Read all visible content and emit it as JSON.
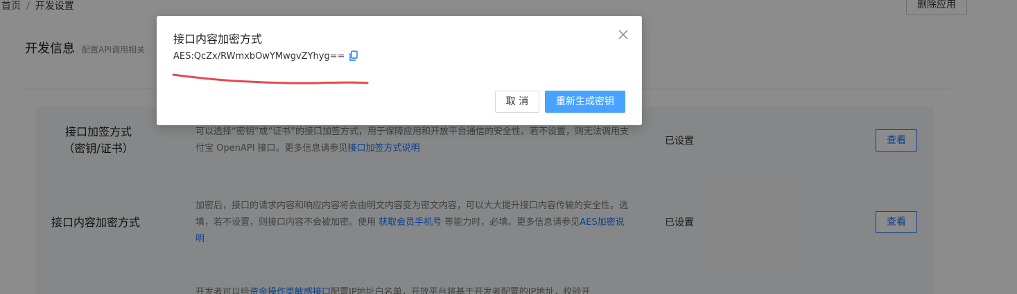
{
  "breadcrumb": {
    "home": "首页",
    "separator": "/",
    "current": "开发设置"
  },
  "header": {
    "delete_button": "删除应用"
  },
  "section": {
    "title": "开发信息",
    "description": "配置API调用相关"
  },
  "rows": [
    {
      "label_line1": "接口加签方式",
      "label_line2": "（密钥/证书）",
      "desc_text1": "可以选择“密钥”或“证书”的接口加签方式，用于保障应用和开放平台通信的安全性。若不设置，则无法调用支付宝 OpenAPI 接口。更多信息请参见",
      "desc_link1": "接口加签方式说明",
      "status": "已设置",
      "button": "查看"
    },
    {
      "label": "接口内容加密方式",
      "desc_text1": "加密后，接口的请求内容和响应内容将会由明文内容变为密文内容，可以大大提升接口内容传输的安全性。选填，若不设置，则接口内容不会被加密。使用 ",
      "desc_link1": "获取会员手机号",
      "desc_text2": " 等能力时，必填。更多信息请参见",
      "desc_link2": "AES加密说明",
      "status": "已设置",
      "button": "查看"
    },
    {
      "desc_text1": "开发者可以给",
      "desc_link1": "资金操作类敏感接口",
      "desc_text2": "配置IP地址白名单，开放平台将基于开发者配置的IP地址，校验开"
    }
  ],
  "modal": {
    "title": "接口内容加密方式",
    "key_label": "AES: ",
    "key_value": "QcZx/RWmxbOwYMwgvZYhyg==",
    "cancel_button": "取 消",
    "regenerate_button": "重新生成密钥"
  },
  "icons": {
    "close": "close-icon",
    "copy": "copy-icon"
  },
  "colors": {
    "link": "#1677ff",
    "primary_button": "#47a3ff",
    "annotation": "#e5484d",
    "overlay": "rgba(0,0,0,0.45)"
  }
}
